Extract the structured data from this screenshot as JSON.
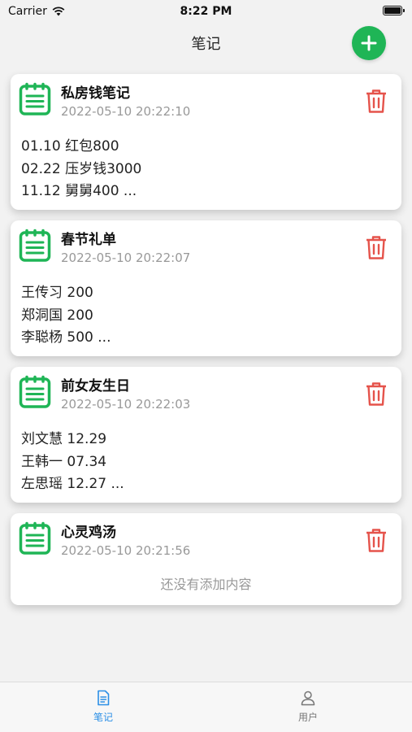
{
  "status_bar": {
    "carrier": "Carrier",
    "time": "8:22 PM"
  },
  "nav": {
    "title": "笔记"
  },
  "notes": [
    {
      "title": "私房钱笔记",
      "time": "2022-05-10 20:22:10",
      "lines": [
        "01.10 红包800",
        "02.22 压岁钱3000",
        "11.12 舅舅400 ..."
      ]
    },
    {
      "title": "春节礼单",
      "time": "2022-05-10 20:22:07",
      "lines": [
        "王传习 200",
        "郑洞国 200",
        "李聪杨 500 ..."
      ]
    },
    {
      "title": "前女友生日",
      "time": "2022-05-10 20:22:03",
      "lines": [
        "刘文慧 12.29",
        "王韩一 07.34",
        "左思瑶 12.27 ..."
      ]
    },
    {
      "title": "心灵鸡汤",
      "time": "2022-05-10 20:21:56",
      "empty_text": "还没有添加内容"
    }
  ],
  "tabs": [
    {
      "label": "笔记",
      "icon": "document-icon",
      "active": true
    },
    {
      "label": "用户",
      "icon": "user-icon",
      "active": false
    }
  ],
  "colors": {
    "accent_green": "#1fb556",
    "delete_red": "#e5534b",
    "tab_active": "#2b8fe6",
    "tab_inactive": "#777777"
  }
}
